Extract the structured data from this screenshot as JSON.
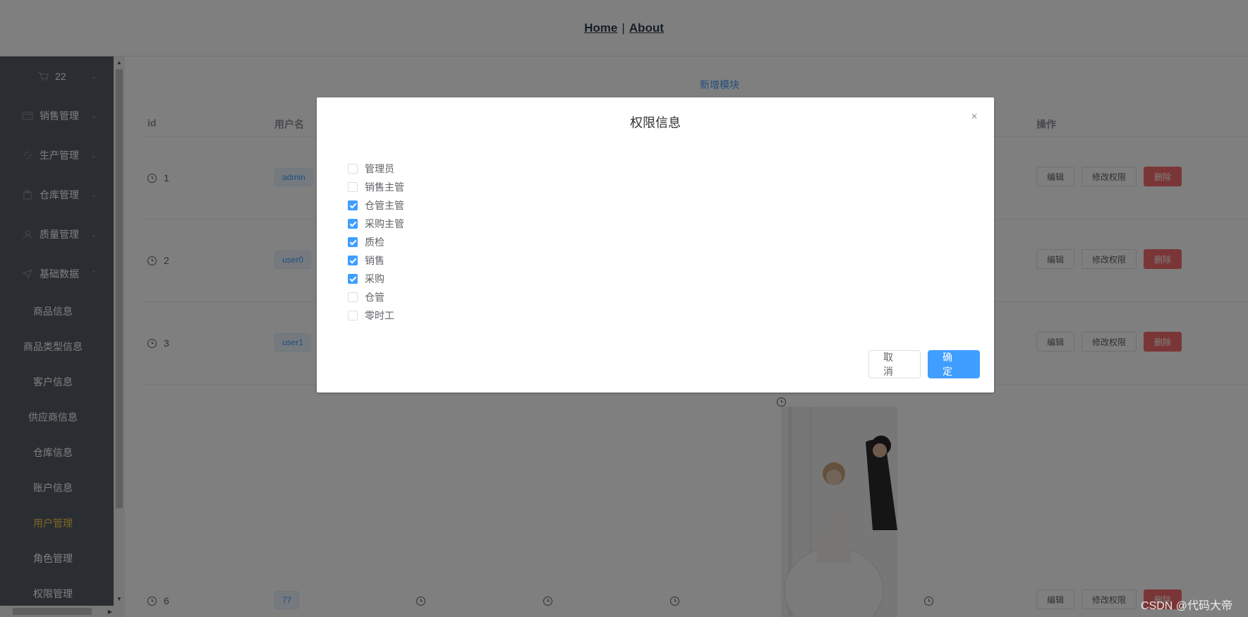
{
  "topnav": {
    "home": "Home",
    "separator": "|",
    "about": "About"
  },
  "sidebar": {
    "top_item": {
      "label": "22",
      "icon": "cart-icon"
    },
    "menus": [
      {
        "label": "销售管理",
        "icon": "sales-icon"
      },
      {
        "label": "生产管理",
        "icon": "production-icon"
      },
      {
        "label": "仓库管理",
        "icon": "warehouse-icon"
      },
      {
        "label": "质量管理",
        "icon": "user-icon"
      },
      {
        "label": "基础数据",
        "icon": "send-icon"
      }
    ],
    "submenu": [
      "商品信息",
      "商品类型信息",
      "客户信息",
      "供应商信息",
      "仓库信息",
      "账户信息",
      "用户管理",
      "角色管理",
      "权限管理"
    ],
    "active_submenu": "用户管理"
  },
  "main": {
    "add_button": "新增模块",
    "columns": {
      "id": "id",
      "username": "用户名",
      "ops": "操作"
    },
    "rows": [
      {
        "id": "1",
        "username": "admin"
      },
      {
        "id": "2",
        "username": "user0"
      },
      {
        "id": "3",
        "username": "user1"
      },
      {
        "id": "6",
        "username": "77"
      }
    ],
    "row_actions": {
      "edit": "编辑",
      "perm": "修改权限",
      "delete": "删除"
    }
  },
  "dialog": {
    "title": "权限信息",
    "close": "×",
    "options": [
      {
        "label": "管理员",
        "checked": false
      },
      {
        "label": "销售主管",
        "checked": false
      },
      {
        "label": "仓管主管",
        "checked": true
      },
      {
        "label": "采购主管",
        "checked": true
      },
      {
        "label": "质检",
        "checked": true
      },
      {
        "label": "销售",
        "checked": true
      },
      {
        "label": "采购",
        "checked": true
      },
      {
        "label": "仓管",
        "checked": false
      },
      {
        "label": "零时工",
        "checked": false
      }
    ],
    "cancel": "取 消",
    "confirm": "确 定"
  },
  "watermark": "CSDN @代码大帝",
  "colors": {
    "primary": "#409eff",
    "danger": "#f56c6c",
    "sidebar": "#545c64",
    "active_menu": "#ffd04b"
  }
}
